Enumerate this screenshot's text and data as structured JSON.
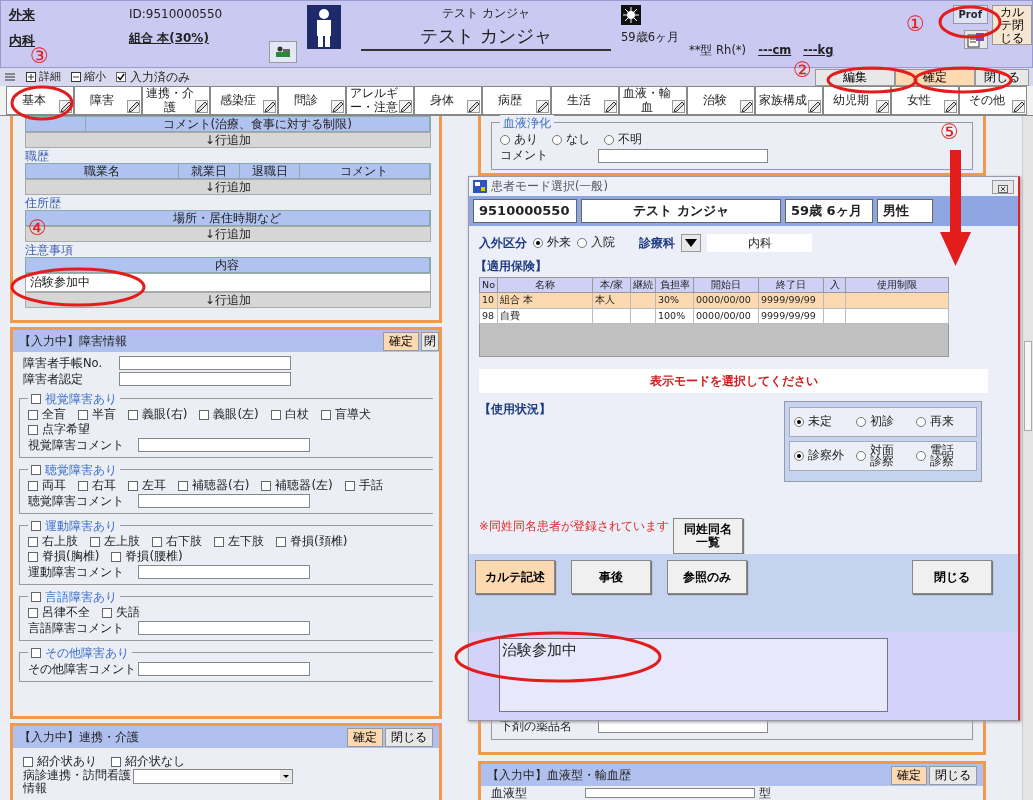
{
  "header": {
    "visit_type": "外来",
    "department": "内科",
    "patient_id": "ID:9510000550",
    "insurance": "組合 本(30%)",
    "name_kana": "テスト カンジャ",
    "name": "テスト カンジャ",
    "age": "59歳6ヶ月",
    "blood_type": "**型 Rh(*)",
    "height": "---cm",
    "weight": "---kg",
    "prof_button": "Prof",
    "close_chart_button": "カルテ閉じる"
  },
  "view_options": {
    "expand": "詳細",
    "collapse": "縮小",
    "entered_only": {
      "label": "入力済のみ",
      "checked": true
    }
  },
  "toolbar_buttons": [
    {
      "label": "編集",
      "highlighted": false
    },
    {
      "label": "確定",
      "highlighted": true
    },
    {
      "label": "閉じる",
      "highlighted": false
    }
  ],
  "tabs": [
    "基本",
    "障害",
    "連携・介護",
    "感染症",
    "問診",
    "アレルギー・注意",
    "身体",
    "病歴",
    "生活",
    "血液・輸血",
    "治験",
    "家族構成",
    "幼児期",
    "女性",
    "その他"
  ],
  "basic_panel": {
    "top_table": {
      "columns": [
        "コメント(治療、食事に対する制限)"
      ],
      "add_row": "↓行追加"
    },
    "sections": [
      {
        "title": "職歴",
        "columns": [
          "職業名",
          "就業日",
          "退職日",
          "コメント"
        ],
        "add_row": "↓行追加"
      },
      {
        "title": "住所歴",
        "columns": [
          "場所・居住時期など"
        ],
        "add_row": "↓行追加"
      },
      {
        "title": "注意事項",
        "columns": [
          "内容"
        ],
        "rows": [
          "治験参加中"
        ],
        "add_row": "↓行追加"
      }
    ]
  },
  "disability_panel": {
    "title": "【入力中】障害情報",
    "buttons": [
      {
        "label": "確定",
        "highlighted": true
      },
      {
        "label": "閉",
        "highlighted": false
      }
    ],
    "fields": [
      "障害者手帳No.",
      "障害者認定"
    ],
    "groups": [
      {
        "title": "視覚障害あり",
        "checked": false,
        "options": [
          {
            "label": "全盲",
            "checked": false
          },
          {
            "label": "半盲",
            "checked": false
          },
          {
            "label": "義眼(右)",
            "checked": false
          },
          {
            "label": "義眼(左)",
            "checked": false
          },
          {
            "label": "白杖",
            "checked": false
          },
          {
            "label": "盲導犬",
            "checked": false
          },
          {
            "label": "点字希望",
            "checked": false
          }
        ],
        "comment_label": "視覚障害コメント"
      },
      {
        "title": "聴覚障害あり",
        "checked": false,
        "options": [
          {
            "label": "両耳",
            "checked": false
          },
          {
            "label": "右耳",
            "checked": false
          },
          {
            "label": "左耳",
            "checked": false
          },
          {
            "label": "補聴器(右)",
            "checked": false
          },
          {
            "label": "補聴器(左)",
            "checked": false
          },
          {
            "label": "手話",
            "checked": false
          }
        ],
        "comment_label": "聴覚障害コメント"
      },
      {
        "title": "運動障害あり",
        "checked": false,
        "options": [
          {
            "label": "右上肢",
            "checked": false
          },
          {
            "label": "左上肢",
            "checked": false
          },
          {
            "label": "右下肢",
            "checked": false
          },
          {
            "label": "左下肢",
            "checked": false
          },
          {
            "label": "脊損(頚椎)",
            "checked": false
          },
          {
            "label": "脊損(胸椎)",
            "checked": false
          },
          {
            "label": "脊損(腰椎)",
            "checked": false
          }
        ],
        "comment_label": "運動障害コメント"
      },
      {
        "title": "言語障害あり",
        "checked": false,
        "options": [
          {
            "label": "呂律不全",
            "checked": false
          },
          {
            "label": "失語",
            "checked": false
          }
        ],
        "comment_label": "言語障害コメント"
      },
      {
        "title": "その他障害あり",
        "checked": false,
        "comment_label": "その他障害コメント"
      }
    ]
  },
  "care_panel": {
    "title": "【入力中】連携・介護",
    "buttons": [
      {
        "label": "確定",
        "highlighted": true
      },
      {
        "label": "閉じる",
        "highlighted": false
      }
    ],
    "options": [
      {
        "label": "紹介状あり",
        "checked": false
      },
      {
        "label": "紹介状なし",
        "checked": false
      }
    ],
    "select_label": "病診連携・訪問看護情報"
  },
  "blood_purification": {
    "legend": "血液浄化",
    "options": [
      {
        "label": "あり",
        "selected": false
      },
      {
        "label": "なし",
        "selected": false
      },
      {
        "label": "不明",
        "selected": false
      }
    ],
    "comment_label": "コメント"
  },
  "laxative": {
    "label": "下剤の薬品名"
  },
  "blood_panel": {
    "title": "【入力中】血液型・輸血歴",
    "buttons": [
      {
        "label": "確定",
        "highlighted": true
      },
      {
        "label": "閉じる",
        "highlighted": false
      }
    ],
    "field_label": "血液型",
    "unit": "型"
  },
  "dialog": {
    "title": "患者モード選択(一般)",
    "patient": [
      "9510000550",
      "テスト カンジャ",
      "59歳 6ヶ月",
      "男性"
    ],
    "inout": {
      "label": "入外区分",
      "options": [
        {
          "label": "外来",
          "selected": true
        },
        {
          "label": "入院",
          "selected": false
        }
      ]
    },
    "department": {
      "label": "診療科",
      "value": "内科"
    },
    "insurance": {
      "title": "【適用保険】",
      "columns": [
        "No",
        "名称",
        "本/家",
        "継続",
        "負担率",
        "開始日",
        "終了日",
        "入",
        "使用制限"
      ],
      "rows": [
        {
          "cells": [
            "10",
            "組合 本",
            "本人",
            "",
            "30%",
            "0000/00/00",
            "9999/99/99",
            "",
            ""
          ],
          "selected": true
        },
        {
          "cells": [
            "98",
            "自費",
            "",
            "",
            "100%",
            "0000/00/00",
            "9999/99/99",
            "",
            ""
          ],
          "selected": false
        }
      ]
    },
    "message": "表示モードを選択してください",
    "usage": {
      "title": "【使用状況】",
      "groups": [
        [
          {
            "label": "未定",
            "selected": true
          },
          {
            "label": "初診",
            "selected": false
          },
          {
            "label": "再来",
            "selected": false
          }
        ],
        [
          {
            "label": "診察外",
            "selected": true
          },
          {
            "label": "対面診察",
            "selected": false
          },
          {
            "label": "電話診察",
            "selected": false
          }
        ]
      ]
    },
    "notice": "※同姓同名患者が登録されています",
    "same_name_button": "同姓同名一覧",
    "actions": [
      {
        "label": "カルテ記述",
        "highlighted": true
      },
      {
        "label": "事後",
        "highlighted": false
      },
      {
        "label": "参照のみ",
        "highlighted": false
      },
      {
        "label": "閉じる",
        "highlighted": false
      }
    ],
    "memo": "治験参加中"
  },
  "annotations": [
    "①",
    "②",
    "③",
    "④",
    "⑤"
  ]
}
